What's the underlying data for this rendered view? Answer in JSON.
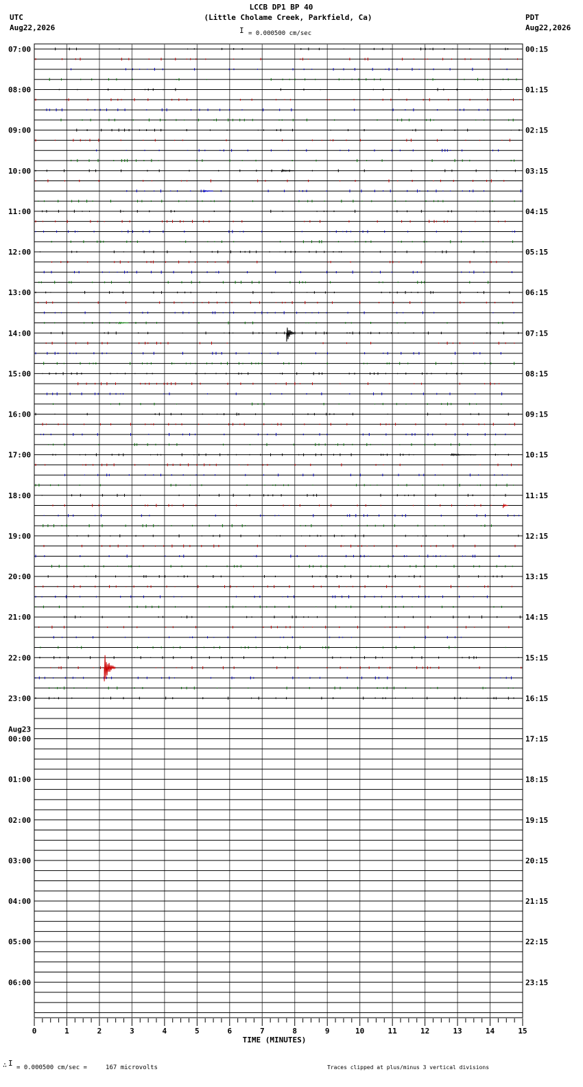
{
  "header": {
    "title": "LCCB DP1 BP 40",
    "subtitle": "(Little Cholame Creek, Parkfield, Ca)",
    "scale": "= 0.000500 cm/sec",
    "left_tz": "UTC",
    "left_date": "Aug22,2026",
    "right_tz": "PDT",
    "right_date": "Aug22,2026"
  },
  "footer": {
    "scale_text": "= 0.000500 cm/sec =     167 microvolts",
    "clip_note": "Traces clipped at plus/minus 3 vertical divisions"
  },
  "chart_data": {
    "type": "line",
    "xlabel": "TIME (MINUTES)",
    "xlim": [
      0,
      15
    ],
    "x_ticks": [
      "0",
      "1",
      "2",
      "3",
      "4",
      "5",
      "6",
      "7",
      "8",
      "9",
      "10",
      "11",
      "12",
      "13",
      "14",
      "15"
    ],
    "date_marker": "Aug23",
    "left_labels": [
      "07:00",
      "08:00",
      "09:00",
      "10:00",
      "11:00",
      "12:00",
      "13:00",
      "14:00",
      "15:00",
      "16:00",
      "17:00",
      "18:00",
      "19:00",
      "20:00",
      "21:00",
      "22:00",
      "23:00",
      "00:00",
      "01:00",
      "02:00",
      "03:00",
      "04:00",
      "05:00",
      "06:00"
    ],
    "right_labels": [
      "00:15",
      "01:15",
      "02:15",
      "03:15",
      "04:15",
      "05:15",
      "06:15",
      "07:15",
      "08:15",
      "09:15",
      "10:15",
      "11:15",
      "12:15",
      "13:15",
      "14:15",
      "15:15",
      "16:15",
      "17:15",
      "18:15",
      "19:15",
      "20:15",
      "21:15",
      "22:15",
      "23:15"
    ],
    "trace_colors": [
      "#000000",
      "#cc0000",
      "#0000cc",
      "#007700"
    ],
    "traces_with_data": 65,
    "total_traces": 96,
    "events": [
      {
        "trace": 12,
        "minute": 7.6,
        "amplitude": 0.15,
        "width": 0.4,
        "color": "#000000"
      },
      {
        "trace": 14,
        "minute": 5.2,
        "amplitude": 0.12,
        "width": 0.3,
        "color": "#0000cc"
      },
      {
        "trace": 28,
        "minute": 7.75,
        "amplitude": 1.0,
        "width": 0.25,
        "color": "#000000"
      },
      {
        "trace": 27,
        "minute": 2.6,
        "amplitude": 0.1,
        "width": 0.3,
        "color": "#007700"
      },
      {
        "trace": 40,
        "minute": 12.8,
        "amplitude": 0.12,
        "width": 0.8,
        "color": "#000000"
      },
      {
        "trace": 45,
        "minute": 14.4,
        "amplitude": 0.25,
        "width": 0.15,
        "color": "#cc0000"
      },
      {
        "trace": 61,
        "minute": 2.15,
        "amplitude": 1.6,
        "width": 0.35,
        "color": "#cc0000"
      }
    ]
  }
}
